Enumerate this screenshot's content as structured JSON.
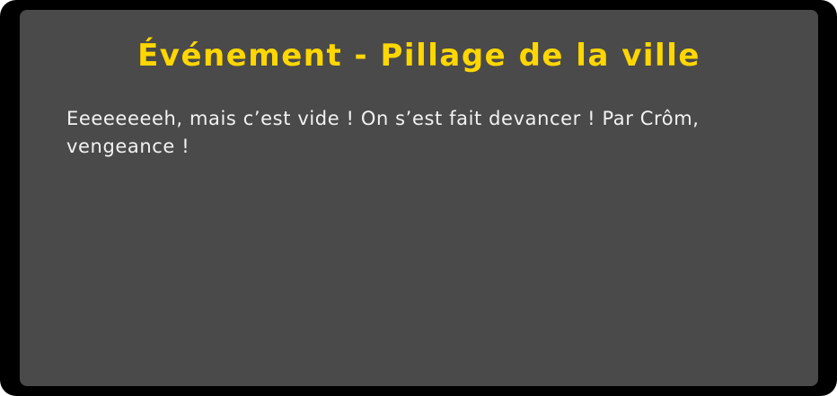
{
  "event": {
    "title": "Événement - Pillage de la ville",
    "text": "Eeeeeeeeh, mais c’est vide ! On s’est fait devancer ! Par Crôm, vengeance !"
  },
  "colors": {
    "frame": "#000000",
    "panel": "#4a4a4a",
    "title": "#ffd700",
    "text": "#f2f2f2"
  }
}
